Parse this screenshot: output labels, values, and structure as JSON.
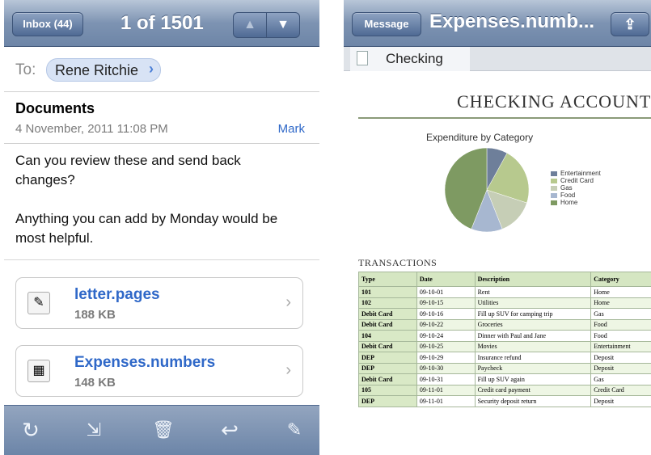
{
  "mail": {
    "nav": {
      "back": "Inbox (44)",
      "title": "1 of 1501"
    },
    "to_label": "To:",
    "recipient": "Rene Ritchie",
    "subject": "Documents",
    "date": "4 November, 2011 11:08 PM",
    "mark": "Mark",
    "body1": "Can you review these and send back changes?",
    "body2": "Anything you can add by Monday would be most helpful.",
    "attachments": [
      {
        "name": "letter.pages",
        "size": "188 KB",
        "icon": "pages-doc-icon"
      },
      {
        "name": "Expenses.numbers",
        "size": "148 KB",
        "icon": "numbers-doc-icon"
      }
    ],
    "toolbar_icons": [
      "refresh-icon",
      "move-folder-icon",
      "trash-icon",
      "reply-icon",
      "compose-icon"
    ]
  },
  "viewer": {
    "nav": {
      "back": "Message",
      "title": "Expenses.numb..."
    },
    "sheet_tab": "Checking",
    "heading": "CHECKING ACCOUNT",
    "chart_title": "Expenditure by Category",
    "transactions_label": "TRANSACTIONS",
    "columns": [
      "Type",
      "Date",
      "Description",
      "Category"
    ],
    "rows": [
      [
        "101",
        "09-10-01",
        "Rent",
        "Home"
      ],
      [
        "102",
        "09-10-15",
        "Utilities",
        "Home"
      ],
      [
        "Debit Card",
        "09-10-16",
        "Fill up SUV for camping trip",
        "Gas"
      ],
      [
        "Debit Card",
        "09-10-22",
        "Groceries",
        "Food"
      ],
      [
        "104",
        "09-10-24",
        "Dinner with Paul and Jane",
        "Food"
      ],
      [
        "Debit Card",
        "09-10-25",
        "Movies",
        "Entertainment"
      ],
      [
        "DEP",
        "09-10-29",
        "Insurance refund",
        "Deposit"
      ],
      [
        "DEP",
        "09-10-30",
        "Paycheck",
        "Deposit"
      ],
      [
        "Debit Card",
        "09-10-31",
        "Fill up SUV again",
        "Gas"
      ],
      [
        "105",
        "09-11-01",
        "Credit card payment",
        "Credit Card"
      ],
      [
        "DEP",
        "09-11-01",
        "Security deposit return",
        "Deposit"
      ]
    ]
  },
  "chart_data": {
    "type": "pie",
    "title": "Expenditure by Category",
    "categories": [
      "Entertainment",
      "Credit Card",
      "Gas",
      "Food",
      "Home"
    ],
    "values": [
      8,
      22,
      14,
      12,
      44
    ],
    "colors": [
      "#6e7f9a",
      "#b7c98e",
      "#c6ceb6",
      "#a7b7d0",
      "#7e9a62"
    ]
  }
}
